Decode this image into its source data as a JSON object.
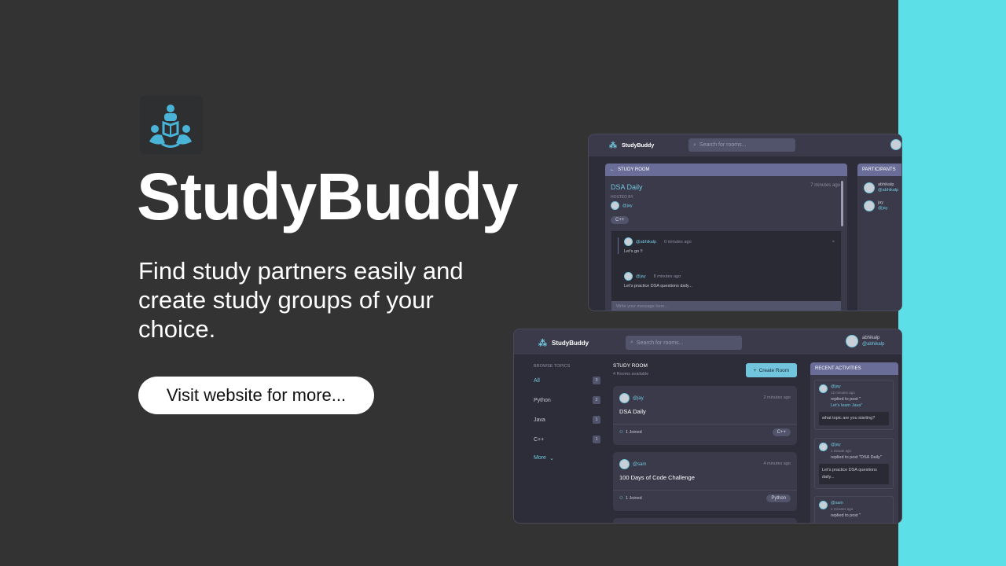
{
  "hero": {
    "title": "StudyBuddy",
    "tagline": "Find study partners easily and create study groups of your choice.",
    "cta": "Visit website for more..."
  },
  "colors": {
    "background": "#333334",
    "accent": "#5ddfe8",
    "mock_bg": "#2d2d39",
    "link": "#71c6dd",
    "panel_head": "#696d97"
  },
  "mock_room": {
    "brand": "StudyBuddy",
    "search_placeholder": "Search for rooms...",
    "panel_title": "STUDY ROOM",
    "room_title": "DSA Daily",
    "room_time": "7 minutes ago",
    "hosted_by_label": "HOSTED BY",
    "host": "@jay",
    "topic": "C++",
    "messages": [
      {
        "user": "@abhikalp",
        "time": "0 minutes ago",
        "text": "Let's go !!"
      },
      {
        "user": "@jay",
        "time": "8 minutes ago",
        "text": "Let's practice DSA questions daily..."
      }
    ],
    "message_placeholder": "Write your message here...",
    "participants_title": "PARTICIPANTS",
    "participants": [
      {
        "name": "abhikalp",
        "handle": "@abhikalp"
      },
      {
        "name": "jay",
        "handle": "@jay"
      }
    ]
  },
  "mock_home": {
    "brand": "StudyBuddy",
    "search_placeholder": "Search for rooms...",
    "user_name": "abhikalp",
    "user_handle": "@abhikalp",
    "browse_title": "BROWSE TOPICS",
    "topics": [
      {
        "name": "All",
        "count": "3"
      },
      {
        "name": "Python",
        "count": "2"
      },
      {
        "name": "Java",
        "count": "1"
      },
      {
        "name": "C++",
        "count": "1"
      }
    ],
    "more": "More",
    "rooms_title": "STUDY ROOM",
    "rooms_available": "4 Rooms available",
    "create_room": "Create Room",
    "rooms": [
      {
        "host": "@jay",
        "time": "2 minutes ago",
        "title": "DSA Daily",
        "joined": "1 Joined",
        "topic": "C++"
      },
      {
        "host": "@sam",
        "time": "4 minutes ago",
        "title": "100 Days of Code Challenge",
        "joined": "1 Joined",
        "topic": "Python"
      }
    ],
    "activities_title": "RECENT ACTIVITIES",
    "activities": [
      {
        "user": "@jay",
        "time": "12 minutes ago",
        "action": "replied to post \"",
        "post": "Let's learn Java\"",
        "quote": "what topic are you starting?"
      },
      {
        "user": "@jay",
        "time": "1 minute ago",
        "action": "replied to post \"DSA Daily\"",
        "post": "",
        "quote": "Let's practice DSA questions daily..."
      },
      {
        "user": "@sam",
        "time": "2 minutes ago",
        "action": "replied to post \"",
        "post": "",
        "quote": ""
      }
    ]
  }
}
